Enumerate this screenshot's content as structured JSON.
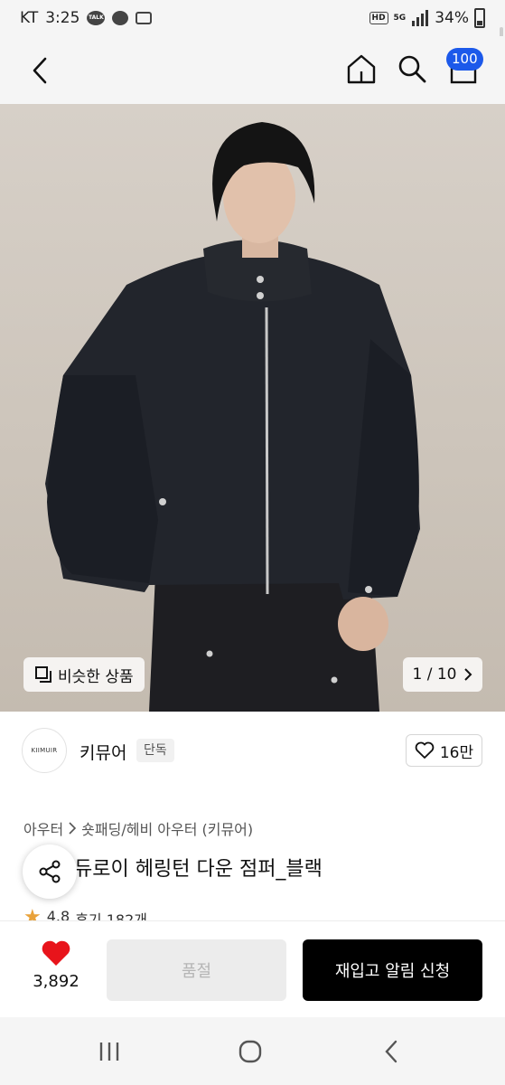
{
  "status_bar": {
    "carrier": "KT",
    "time": "3:25",
    "battery": "34%",
    "icons": [
      "kakaotalk-icon",
      "face-icon",
      "tv-icon",
      "hd-icon",
      "5g-icon",
      "signal-icon",
      "battery-icon"
    ],
    "hd_label": "HD",
    "network_label": "5G"
  },
  "header": {
    "cart_count": "100",
    "accent_color": "#1c59ea"
  },
  "gallery": {
    "similar_label": "비슷한 상품",
    "page_indicator": "1 / 10"
  },
  "brand": {
    "logo_text": "KIIMUIR",
    "name": "키뮤어",
    "tag": "단독",
    "like_count": "16만"
  },
  "product": {
    "breadcrumb": [
      "아우터",
      "숏패딩/헤비 아우터 (키뮤어)"
    ],
    "title_visible": "운) 코듀로이 헤링턴 다운 점퍼_블랙",
    "rating": "4.8",
    "review_label": "후기 182개"
  },
  "actions": {
    "wish_count": "3,892",
    "soldout_label": "품절",
    "restock_label": "재입고 알림 신청"
  }
}
